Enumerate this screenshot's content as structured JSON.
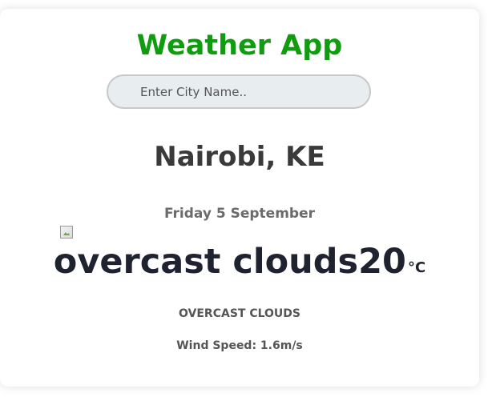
{
  "app": {
    "title": "Weather App",
    "title_color": "#0f9d0f"
  },
  "search": {
    "placeholder": "Enter City Name..",
    "value": ""
  },
  "weather": {
    "location": "Nairobi, KE",
    "date": "Friday 5 September",
    "icon_alt": "overcast clouds",
    "temperature": "20",
    "unit": "°C",
    "description": "OVERCAST CLOUDS",
    "wind": "Wind Speed: 1.6m/s"
  }
}
